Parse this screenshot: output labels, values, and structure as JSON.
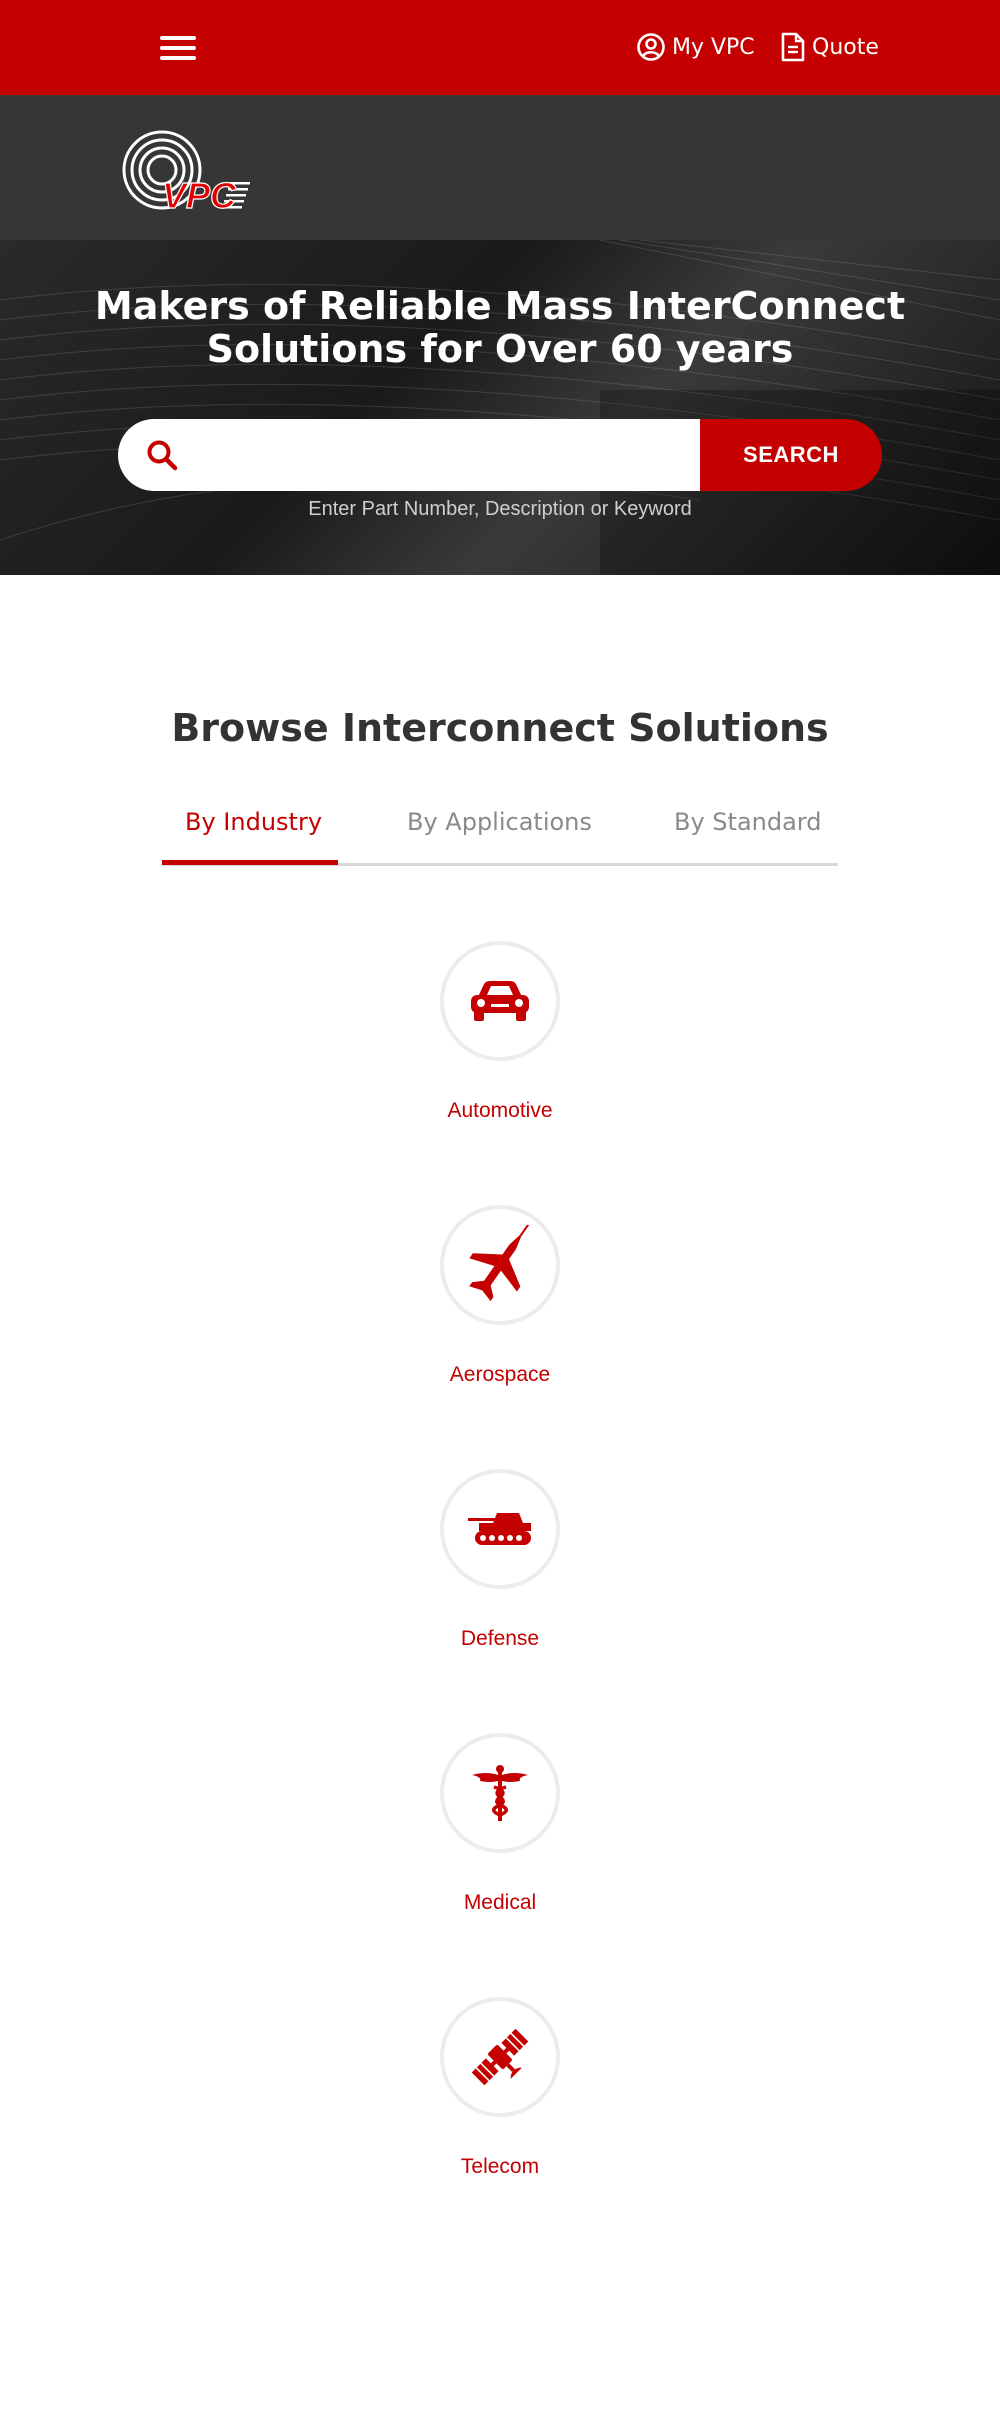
{
  "header": {
    "menu_icon": "hamburger-icon",
    "my_vpc_label": "My VPC",
    "my_vpc_icon": "user-circle-icon",
    "quote_label": "Quote",
    "quote_icon": "document-icon",
    "colors": {
      "red": "#c40000",
      "dark": "#363636"
    }
  },
  "logo": {
    "text": "VPC"
  },
  "hero": {
    "title_line1": "Makers of Reliable Mass InterConnect",
    "title_line2": "Solutions for Over 60 years",
    "search": {
      "icon": "search-icon",
      "placeholder": "",
      "value": "",
      "button_label": "SEARCH",
      "hint": "Enter Part Number, Description or Keyword"
    }
  },
  "browse": {
    "title": "Browse Interconnect Solutions",
    "tabs": [
      {
        "label": "By Industry",
        "active": true
      },
      {
        "label": "By Applications",
        "active": false
      },
      {
        "label": "By Standard",
        "active": false
      }
    ],
    "industries": [
      {
        "label": "Automotive",
        "icon": "car-icon"
      },
      {
        "label": "Aerospace",
        "icon": "jet-icon"
      },
      {
        "label": "Defense",
        "icon": "tank-icon"
      },
      {
        "label": "Medical",
        "icon": "caduceus-icon"
      },
      {
        "label": "Telecom",
        "icon": "satellite-icon"
      }
    ]
  }
}
